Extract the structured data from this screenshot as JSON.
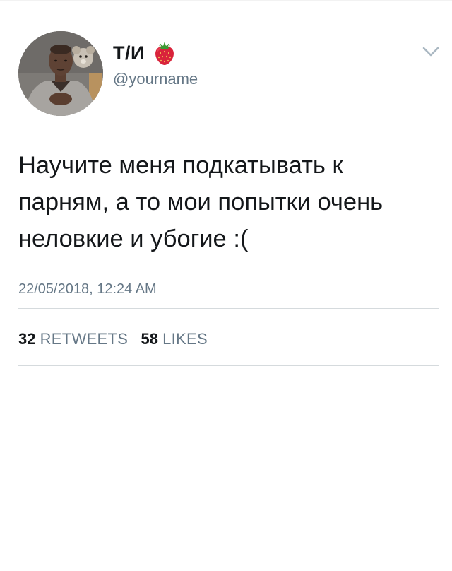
{
  "tweet": {
    "author": {
      "display_name": "Т/И",
      "handle": "@yourname",
      "name_emoji": "strawberry-icon",
      "avatar": "profile-photo"
    },
    "text": "Научите меня подкатывать к парням, а то мои попытки очень неловкие и убогие :(",
    "timestamp": "22/05/2018, 12:24 AM",
    "stats": {
      "retweets_count": "32",
      "retweets_label": "RETWEETS",
      "likes_count": "58",
      "likes_label": "LIKES"
    },
    "menu_icon": "chevron-down-icon"
  },
  "colors": {
    "text_primary": "#14171a",
    "text_secondary": "#657786",
    "divider": "#d5dadd",
    "chevron": "#aab8c2",
    "strawberry": "#d9233b"
  }
}
